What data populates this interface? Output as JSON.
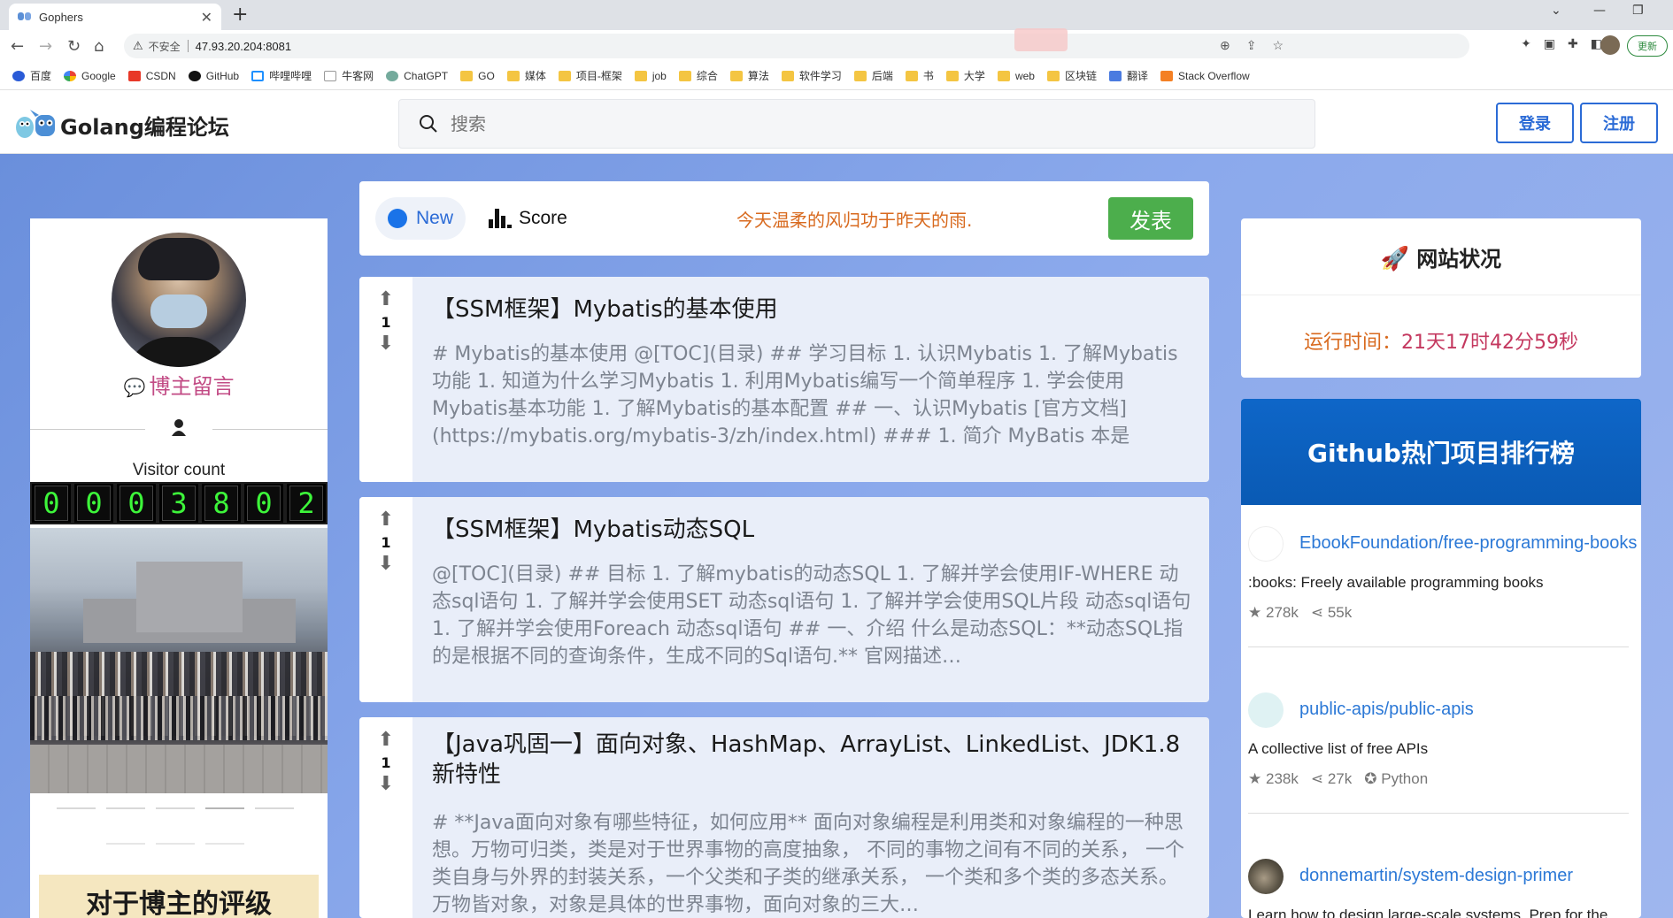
{
  "browser": {
    "tab_title": "Gophers",
    "insecure_label": "不安全",
    "url": "47.93.20.204:8081",
    "update_label": "更新",
    "bookmarks": [
      "百度",
      "Google",
      "CSDN",
      "GitHub",
      "哔哩哔哩",
      "牛客网",
      "ChatGPT",
      "GO",
      "媒体",
      "项目-框架",
      "job",
      "综合",
      "算法",
      "软件学习",
      "后端",
      "书",
      "大学",
      "web",
      "区块链",
      "翻译",
      "Stack Overflow"
    ]
  },
  "header": {
    "site_title": "Golang编程论坛",
    "search_placeholder": "搜索",
    "login_label": "登录",
    "register_label": "注册"
  },
  "left": {
    "message_link": "博主留言",
    "visitor_label": "Visitor count",
    "visitor_digits": [
      "0",
      "0",
      "0",
      "3",
      "8",
      "0",
      "2"
    ],
    "rating_title": "对于博主的评级"
  },
  "feed": {
    "tab_new": "New",
    "tab_score": "Score",
    "motto": "今天温柔的风归功于昨天的雨.",
    "post_button": "发表",
    "posts": [
      {
        "votes": "1",
        "title": "【SSM框架】Mybatis的基本使用",
        "excerpt": "# Mybatis的基本使用 @[TOC](目录) ## 学习目标 1. 认识Mybatis 1. 了解Mybatis功能 1. 知道为什么学习Mybatis 1. 利用Mybatis编写一个简单程序 1. 学会使用Mybatis基本功能 1. 了解Mybatis的基本配置 ## 一、认识Mybatis [官方文档](https://mybatis.org/mybatis-3/zh/index.html) ### 1. 简介 MyBatis 本是[apach…"
      },
      {
        "votes": "1",
        "title": "【SSM框架】Mybatis动态SQL",
        "excerpt": "@[TOC](目录) ## 目标 1. 了解mybatis的动态SQL 1. 了解并学会使用IF-WHERE 动态sql语句 1. 了解并学会使用SET 动态sql语句 1. 了解并学会使用SQL片段 动态sql语句 1. 了解并学会使用Foreach 动态sql语句 ## 一、介绍 什么是动态SQL：**动态SQL指的是根据不同的查询条件，生成不同的Sql语句.** 官网描述…"
      },
      {
        "votes": "1",
        "title": "【Java巩固一】面向对象、HashMap、ArrayList、LinkedList、JDK1.8新特性",
        "excerpt": "# **Java面向对象有哪些特征，如何应用** 面向对象编程是利用类和对象编程的一种思想。万物可归类，类是对于世界事物的高度抽象， 不同的事物之间有不同的关系， 一个类自身与外界的封装关系，一个父类和子类的继承关系， 一个类和多个类的多态关系。万物皆对象，对象是具体的世界事物，面向对象的三大…"
      }
    ]
  },
  "right": {
    "status_title": "网站状况",
    "uptime_label": "运行时间：",
    "uptime_value": "21天17时42分59秒",
    "github_title": "Github热门项目排行榜",
    "repos": [
      {
        "name": "EbookFoundation/free-programming-books",
        "desc": ":books: Freely available programming books",
        "stars": "278k",
        "forks": "55k",
        "lang": ""
      },
      {
        "name": "public-apis/public-apis",
        "desc": "A collective list of free APIs",
        "stars": "238k",
        "forks": "27k",
        "lang": "Python"
      },
      {
        "name": "donnemartin/system-design-primer",
        "desc": "Learn how to design large-scale systems. Prep for the",
        "stars": "",
        "forks": "",
        "lang": ""
      }
    ]
  }
}
